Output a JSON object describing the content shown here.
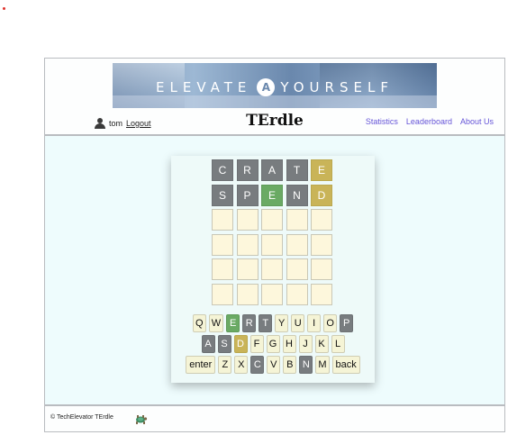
{
  "banner": {
    "left_text": "ELEVATE",
    "logo_letter": "A",
    "right_text": "YOURSELF"
  },
  "header": {
    "username": "tom",
    "logout_label": "Logout",
    "title": "TErdle",
    "nav": [
      "Statistics",
      "Leaderboard",
      "About Us"
    ]
  },
  "board": {
    "rows": [
      [
        {
          "letter": "C",
          "state": "absent"
        },
        {
          "letter": "R",
          "state": "absent"
        },
        {
          "letter": "A",
          "state": "absent"
        },
        {
          "letter": "T",
          "state": "absent"
        },
        {
          "letter": "E",
          "state": "present"
        }
      ],
      [
        {
          "letter": "S",
          "state": "absent"
        },
        {
          "letter": "P",
          "state": "absent"
        },
        {
          "letter": "E",
          "state": "correct"
        },
        {
          "letter": "N",
          "state": "absent"
        },
        {
          "letter": "D",
          "state": "present"
        }
      ],
      [
        {
          "letter": "",
          "state": "empty"
        },
        {
          "letter": "",
          "state": "empty"
        },
        {
          "letter": "",
          "state": "empty"
        },
        {
          "letter": "",
          "state": "empty"
        },
        {
          "letter": "",
          "state": "empty"
        }
      ],
      [
        {
          "letter": "",
          "state": "empty"
        },
        {
          "letter": "",
          "state": "empty"
        },
        {
          "letter": "",
          "state": "empty"
        },
        {
          "letter": "",
          "state": "empty"
        },
        {
          "letter": "",
          "state": "empty"
        }
      ],
      [
        {
          "letter": "",
          "state": "empty"
        },
        {
          "letter": "",
          "state": "empty"
        },
        {
          "letter": "",
          "state": "empty"
        },
        {
          "letter": "",
          "state": "empty"
        },
        {
          "letter": "",
          "state": "empty"
        }
      ],
      [
        {
          "letter": "",
          "state": "empty"
        },
        {
          "letter": "",
          "state": "empty"
        },
        {
          "letter": "",
          "state": "empty"
        },
        {
          "letter": "",
          "state": "empty"
        },
        {
          "letter": "",
          "state": "empty"
        }
      ]
    ]
  },
  "keyboard": {
    "rows": [
      [
        {
          "label": "Q",
          "state": "unused"
        },
        {
          "label": "W",
          "state": "unused"
        },
        {
          "label": "E",
          "state": "correct"
        },
        {
          "label": "R",
          "state": "absent"
        },
        {
          "label": "T",
          "state": "absent"
        },
        {
          "label": "Y",
          "state": "unused"
        },
        {
          "label": "U",
          "state": "unused"
        },
        {
          "label": "I",
          "state": "unused"
        },
        {
          "label": "O",
          "state": "unused"
        },
        {
          "label": "P",
          "state": "absent"
        }
      ],
      [
        {
          "label": "A",
          "state": "absent"
        },
        {
          "label": "S",
          "state": "absent"
        },
        {
          "label": "D",
          "state": "present"
        },
        {
          "label": "F",
          "state": "unused"
        },
        {
          "label": "G",
          "state": "unused"
        },
        {
          "label": "H",
          "state": "unused"
        },
        {
          "label": "J",
          "state": "unused"
        },
        {
          "label": "K",
          "state": "unused"
        },
        {
          "label": "L",
          "state": "unused"
        }
      ],
      [
        {
          "label": "enter",
          "state": "unused"
        },
        {
          "label": "Z",
          "state": "unused"
        },
        {
          "label": "X",
          "state": "unused"
        },
        {
          "label": "C",
          "state": "absent"
        },
        {
          "label": "V",
          "state": "unused"
        },
        {
          "label": "B",
          "state": "unused"
        },
        {
          "label": "N",
          "state": "absent"
        },
        {
          "label": "M",
          "state": "unused"
        },
        {
          "label": "back",
          "state": "unused"
        }
      ]
    ]
  },
  "footer": {
    "text": "© TechElevator TErdle",
    "icon": "turtle-icon"
  },
  "colors": {
    "absent": "#787c7f",
    "present": "#c9b458",
    "correct": "#6aaa64",
    "empty_tile": "#fdf7dc",
    "key": "#f5f4d6",
    "link": "#6655d8"
  }
}
